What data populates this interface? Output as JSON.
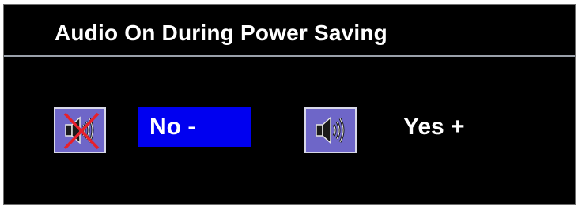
{
  "osd": {
    "title": "Audio On During Power Saving",
    "options": [
      {
        "label": "No -",
        "icon": "speaker-muted-icon",
        "selected": true
      },
      {
        "label": "Yes +",
        "icon": "speaker-on-icon",
        "selected": false
      }
    ]
  },
  "colors": {
    "panel_background": "#000000",
    "text": "#ffffff",
    "selection_highlight": "#0000f0",
    "icon_background": "#6e66c8",
    "mute_cross": "#e8202a"
  }
}
